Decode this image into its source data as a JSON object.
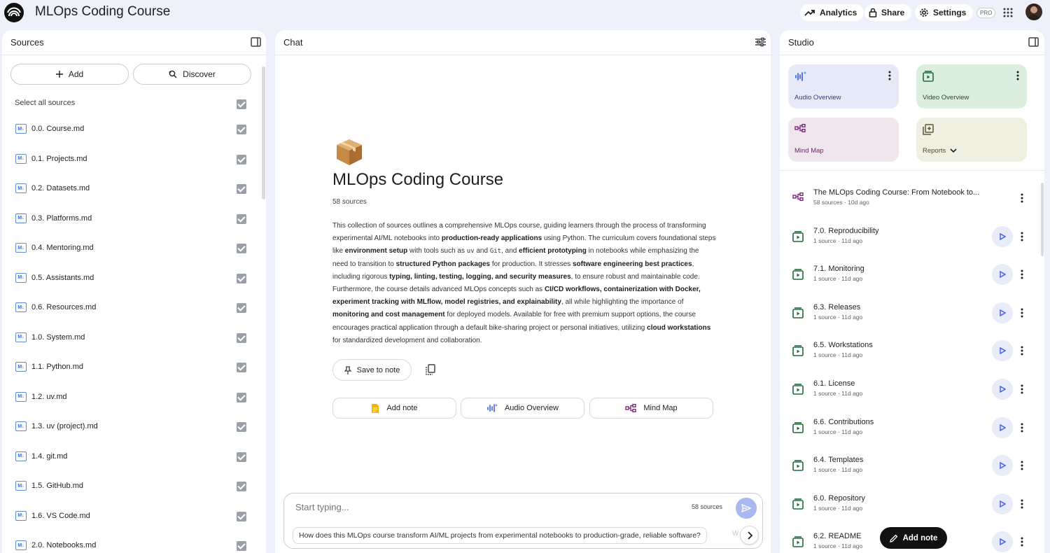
{
  "app": {
    "title": "MLOps Coding Course"
  },
  "topbar": {
    "analytics": "Analytics",
    "share": "Share",
    "settings": "Settings",
    "pro": "PRO"
  },
  "sources": {
    "title": "Sources",
    "add": "Add",
    "discover": "Discover",
    "select_all": "Select all sources",
    "items": [
      "0.0. Course.md",
      "0.1. Projects.md",
      "0.2. Datasets.md",
      "0.3. Platforms.md",
      "0.4. Mentoring.md",
      "0.5. Assistants.md",
      "0.6. Resources.md",
      "1.0. System.md",
      "1.1. Python.md",
      "1.2. uv.md",
      "1.3. uv (project).md",
      "1.4. git.md",
      "1.5. GitHub.md",
      "1.6. VS Code.md",
      "2.0. Notebooks.md"
    ],
    "md_badge": "M↓"
  },
  "chat": {
    "title": "Chat",
    "notebook_title": "MLOps Coding Course",
    "source_count": "58 sources",
    "summary": [
      {
        "t": "This collection of sources outlines a comprehensive MLOps course, guiding learners through the process of transforming experimental AI/ML notebooks into "
      },
      {
        "b": "production-ready applications"
      },
      {
        "t": " using Python. The curriculum covers foundational steps like "
      },
      {
        "b": "environment setup"
      },
      {
        "t": " with tools such as "
      },
      {
        "c": "uv"
      },
      {
        "t": " and "
      },
      {
        "c": "Git"
      },
      {
        "t": ", and "
      },
      {
        "b": "efficient prototyping"
      },
      {
        "t": " in notebooks while emphasizing the need to transition to "
      },
      {
        "b": "structured Python packages"
      },
      {
        "t": " for production. It stresses "
      },
      {
        "b": "software engineering best practices"
      },
      {
        "t": ", including rigorous "
      },
      {
        "b": "typing, linting, testing, logging, and security measures"
      },
      {
        "t": ", to ensure robust and maintainable code. Furthermore, the course details advanced MLOps concepts such as "
      },
      {
        "b": "CI/CD workflows, containerization with Docker, experiment tracking with MLflow, model registries, and explainability"
      },
      {
        "t": ", all while highlighting the importance of "
      },
      {
        "b": "monitoring and cost management"
      },
      {
        "t": " for deployed models. Available for free with premium support options, the course encourages practical application through a default bike-sharing project or personal initiatives, utilizing "
      },
      {
        "b": "cloud workstations"
      },
      {
        "t": " for standardized development and collaboration."
      }
    ],
    "save_to_note": "Save to note",
    "chips": {
      "add_note": "Add note",
      "audio_overview": "Audio Overview",
      "mind_map": "Mind Map"
    },
    "composer": {
      "placeholder": "Start typing...",
      "count": "58 sources",
      "suggestion": "How does this MLOps course transform AI/ML projects from experimental notebooks to production-grade, reliable software?",
      "suggestion_next": "W"
    }
  },
  "studio": {
    "title": "Studio",
    "tiles": {
      "audio": "Audio Overview",
      "video": "Video Overview",
      "mindmap": "Mind Map",
      "reports": "Reports"
    },
    "notes": [
      {
        "title": "The MLOps Coding Course: From Notebook to...",
        "meta": "58 sources · 10d ago",
        "kind": "mindmap"
      },
      {
        "title": "7.0. Reproducibility",
        "meta": "1 source · 11d ago",
        "kind": "video"
      },
      {
        "title": "7.1. Monitoring",
        "meta": "1 source · 11d ago",
        "kind": "video"
      },
      {
        "title": "6.3. Releases",
        "meta": "1 source · 11d ago",
        "kind": "video"
      },
      {
        "title": "6.5. Workstations",
        "meta": "1 source · 11d ago",
        "kind": "video"
      },
      {
        "title": "6.1. License",
        "meta": "1 source · 11d ago",
        "kind": "video"
      },
      {
        "title": "6.6. Contributions",
        "meta": "1 source · 11d ago",
        "kind": "video"
      },
      {
        "title": "6.4. Templates",
        "meta": "1 source · 11d ago",
        "kind": "video"
      },
      {
        "title": "6.0. Repository",
        "meta": "1 source · 11d ago",
        "kind": "video"
      },
      {
        "title": "6.2. README",
        "meta": "1 source · 11d ago",
        "kind": "video"
      }
    ],
    "add_note": "Add note"
  },
  "colors": {
    "page_bg": "#eef1fa",
    "audio_tile": "#e6eaf7",
    "video_tile": "#dcefdf",
    "mindmap_tile": "#f0e6ee",
    "reports_tile": "#efefe2",
    "video_green": "#1e6b3b",
    "mindmap_purple": "#7a2a78",
    "accent_blue": "#3d5af1"
  }
}
